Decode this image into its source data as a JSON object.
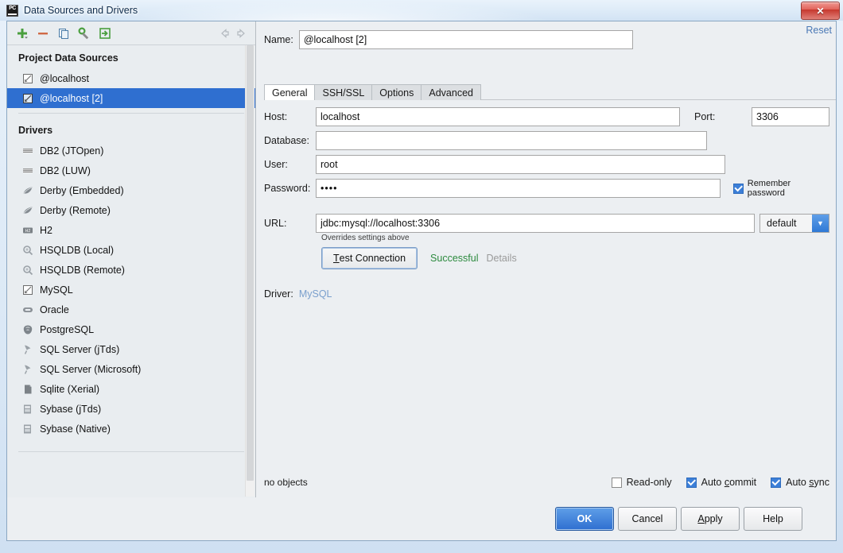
{
  "window": {
    "title": "Data Sources and Drivers",
    "app_icon": "pycharm-icon",
    "close_label": "✕"
  },
  "toolbar": {
    "buttons": [
      {
        "name": "add-button",
        "icon": "plus-icon"
      },
      {
        "name": "remove-button",
        "icon": "minus-icon"
      },
      {
        "name": "copy-button",
        "icon": "copy-icon"
      },
      {
        "name": "driver-properties-button",
        "icon": "wrench-icon"
      },
      {
        "name": "import-button",
        "icon": "import-icon"
      }
    ],
    "nav_back": "back-arrow-icon",
    "nav_forward": "forward-arrow-icon"
  },
  "sidebar": {
    "project_section": "Project Data Sources",
    "data_sources": [
      {
        "label": "@localhost",
        "icon": "mysql-icon",
        "selected": false
      },
      {
        "label": "@localhost [2]",
        "icon": "mysql-icon",
        "selected": true
      }
    ],
    "drivers_section": "Drivers",
    "drivers": [
      {
        "label": "DB2 (JTOpen)",
        "icon": "ibm-icon"
      },
      {
        "label": "DB2 (LUW)",
        "icon": "ibm-icon"
      },
      {
        "label": "Derby (Embedded)",
        "icon": "derby-icon"
      },
      {
        "label": "Derby (Remote)",
        "icon": "derby-icon"
      },
      {
        "label": "H2",
        "icon": "h2-icon"
      },
      {
        "label": "HSQLDB (Local)",
        "icon": "hsqldb-icon"
      },
      {
        "label": "HSQLDB (Remote)",
        "icon": "hsqldb-icon"
      },
      {
        "label": "MySQL",
        "icon": "mysql-icon"
      },
      {
        "label": "Oracle",
        "icon": "oracle-icon"
      },
      {
        "label": "PostgreSQL",
        "icon": "postgresql-icon"
      },
      {
        "label": "SQL Server (jTds)",
        "icon": "sqlserver-icon"
      },
      {
        "label": "SQL Server (Microsoft)",
        "icon": "sqlserver-icon"
      },
      {
        "label": "Sqlite (Xerial)",
        "icon": "sqlite-icon"
      },
      {
        "label": "Sybase (jTds)",
        "icon": "sybase-icon"
      },
      {
        "label": "Sybase (Native)",
        "icon": "sybase-icon"
      }
    ]
  },
  "detail": {
    "name_label": "Name:",
    "name_value": "@localhost [2]",
    "reset_label": "Reset",
    "tabs": [
      {
        "label": "General",
        "active": true
      },
      {
        "label": "SSH/SSL",
        "active": false
      },
      {
        "label": "Options",
        "active": false
      },
      {
        "label": "Advanced",
        "active": false
      }
    ],
    "host_label": "Host:",
    "host_value": "localhost",
    "port_label": "Port:",
    "port_value": "3306",
    "database_label": "Database:",
    "database_value": "",
    "user_label": "User:",
    "user_value": "root",
    "password_label": "Password:",
    "password_value": "••••",
    "remember_password_label": "Remember password",
    "remember_password_checked": true,
    "url_label": "URL:",
    "url_value": "jdbc:mysql://localhost:3306",
    "url_scheme_value": "default",
    "override_note": "Overrides settings above",
    "test_connection_label": "Test Connection",
    "test_connection_mnemonic": "T",
    "status_text": "Successful",
    "status_color": "#2c8a3e",
    "details_label": "Details",
    "driver_label": "Driver:",
    "driver_value": "MySQL"
  },
  "footer": {
    "objects_text": "no objects",
    "options": [
      {
        "label": "Read-only",
        "checked": false,
        "mnemonic": ""
      },
      {
        "label": "Auto commit",
        "checked": true,
        "mnemonic": "c"
      },
      {
        "label": "Auto sync",
        "checked": true,
        "mnemonic": "s"
      }
    ]
  },
  "buttons": {
    "ok": "OK",
    "cancel": "Cancel",
    "apply": "Apply",
    "help": "Help"
  },
  "colors": {
    "accent": "#2f6fd0",
    "success": "#2c8a3e",
    "link": "#4a78b5",
    "selection": "#2f6fd0"
  }
}
